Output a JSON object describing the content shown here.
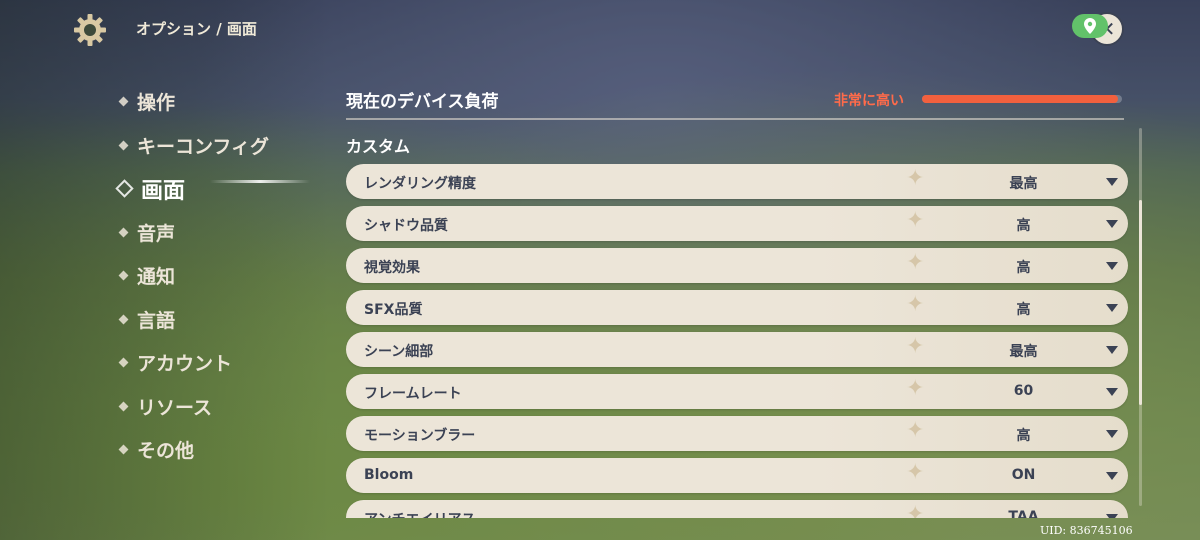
{
  "header": {
    "breadcrumb": "オプション / 画面"
  },
  "nav": {
    "items": [
      {
        "label": "操作",
        "active": false
      },
      {
        "label": "キーコンフィグ",
        "active": false
      },
      {
        "label": "画面",
        "active": true
      },
      {
        "label": "音声",
        "active": false
      },
      {
        "label": "通知",
        "active": false
      },
      {
        "label": "言語",
        "active": false
      },
      {
        "label": "アカウント",
        "active": false
      },
      {
        "label": "リソース",
        "active": false
      },
      {
        "label": "その他",
        "active": false
      }
    ]
  },
  "device_load": {
    "title": "現在のデバイス負荷",
    "value": "非常に高い",
    "level": 0.98,
    "color": "#f2603e"
  },
  "custom": {
    "section_title": "カスタム",
    "settings": [
      {
        "label": "レンダリング精度",
        "value": "最高"
      },
      {
        "label": "シャドウ品質",
        "value": "高"
      },
      {
        "label": "視覚効果",
        "value": "高"
      },
      {
        "label": "SFX品質",
        "value": "高"
      },
      {
        "label": "シーン細部",
        "value": "最高"
      },
      {
        "label": "フレームレート",
        "value": "60"
      },
      {
        "label": "モーションブラー",
        "value": "高"
      },
      {
        "label": "Bloom",
        "value": "ON"
      },
      {
        "label": "アンチエイリアス",
        "value": "TAA"
      }
    ]
  },
  "footer": {
    "uid": "UID: 836745106"
  },
  "icons": {
    "settings": "gear-icon",
    "close": "close-icon",
    "map_pin": "location-pin-icon",
    "dropdown": "chevron-down-icon"
  }
}
